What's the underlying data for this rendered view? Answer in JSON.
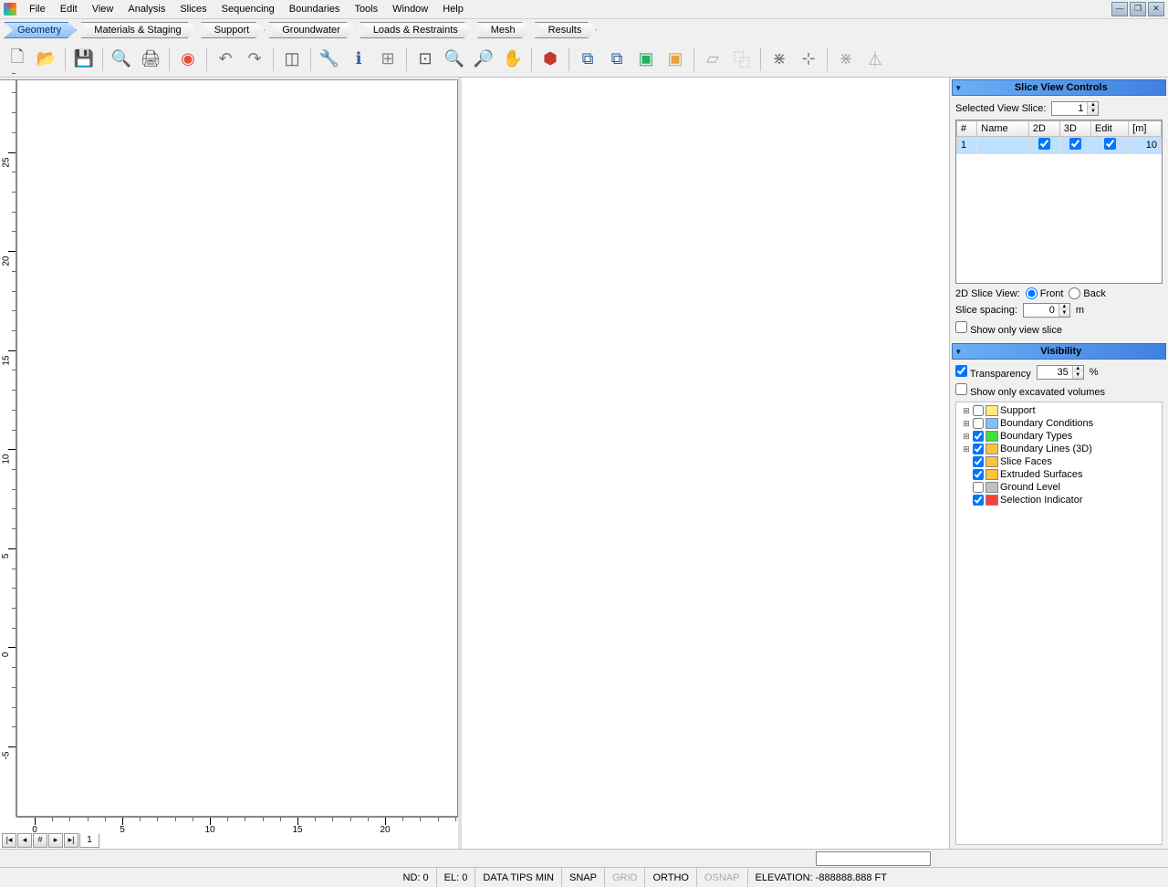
{
  "menu": [
    "File",
    "Edit",
    "View",
    "Analysis",
    "Slices",
    "Sequencing",
    "Boundaries",
    "Tools",
    "Window",
    "Help"
  ],
  "steps": [
    "Geometry",
    "Materials & Staging",
    "Support",
    "Groundwater",
    "Loads & Restraints",
    "Mesh",
    "Results"
  ],
  "activeStep": 0,
  "ruler": {
    "v_labels": [
      "-5",
      "0",
      "5",
      "10",
      "15",
      "20",
      "25"
    ],
    "h_labels": [
      "0",
      "5",
      "10",
      "15",
      "20"
    ]
  },
  "nav": {
    "tab": "1"
  },
  "sliceControls": {
    "title": "Slice View Controls",
    "label_selected": "Selected View Slice:",
    "selected": "1",
    "headers": [
      "#",
      "Name",
      "2D",
      "3D",
      "Edit",
      "[m]"
    ],
    "row": {
      "num": "1",
      "name": "",
      "d2": true,
      "d3": true,
      "edit": true,
      "m": "10"
    },
    "label_2d": "2D Slice View:",
    "opt_front": "Front",
    "opt_back": "Back",
    "label_spacing": "Slice spacing:",
    "spacing": "0",
    "spacing_unit": "m",
    "label_only": "Show only view slice",
    "only": false
  },
  "visibility": {
    "title": "Visibility",
    "transp_label": "Transparency",
    "transp_value": "35",
    "transp_unit": "%",
    "excavated_label": "Show only excavated volumes",
    "excavated": false,
    "tree": [
      {
        "exp": "+",
        "checked": false,
        "label": "Support",
        "color": "#ffeb7f"
      },
      {
        "exp": "+",
        "checked": false,
        "label": "Boundary Conditions",
        "color": "#7fbfff"
      },
      {
        "exp": "+",
        "checked": true,
        "label": "Boundary Types",
        "color": "#40e040"
      },
      {
        "exp": "+",
        "checked": true,
        "label": "Boundary Lines (3D)",
        "color": "#ffc040"
      },
      {
        "exp": "",
        "checked": true,
        "label": "Slice Faces",
        "color": "#ffc040"
      },
      {
        "exp": "",
        "checked": true,
        "label": "Extruded Surfaces",
        "color": "#ffc040"
      },
      {
        "exp": "",
        "checked": false,
        "label": "Ground Level",
        "color": "#c0c0c0"
      },
      {
        "exp": "",
        "checked": true,
        "label": "Selection Indicator",
        "color": "#ff4040"
      }
    ]
  },
  "status": {
    "nd": "ND: 0",
    "el": "EL: 0",
    "dtips": "DATA TIPS MIN",
    "snap": "SNAP",
    "grid": "GRID",
    "ortho": "ORTHO",
    "osnap": "OSNAP",
    "elev": "ELEVATION: -888888.888 FT"
  },
  "toolbar_icons": [
    {
      "n": "new-file-icon",
      "g": "🗋",
      "c": "#666"
    },
    {
      "n": "open-folder-icon",
      "g": "📂",
      "c": "#e6a23c"
    },
    {
      "sep": true
    },
    {
      "n": "save-icon",
      "g": "💾",
      "c": "#2c5aa0"
    },
    {
      "sep": true
    },
    {
      "n": "print-preview-icon",
      "g": "🔍",
      "c": "#555"
    },
    {
      "n": "print-icon",
      "g": "🖨",
      "c": "#555"
    },
    {
      "sep": true
    },
    {
      "n": "color-wheel-icon",
      "g": "◉",
      "c": "#e74c3c"
    },
    {
      "sep": true
    },
    {
      "n": "undo-icon",
      "g": "↶",
      "c": "#777"
    },
    {
      "n": "redo-icon",
      "g": "↷",
      "c": "#777"
    },
    {
      "sep": true
    },
    {
      "n": "split-view-icon",
      "g": "◫",
      "c": "#555"
    },
    {
      "sep": true
    },
    {
      "n": "settings-wrench-icon",
      "g": "🔧",
      "c": "#c0392b"
    },
    {
      "n": "info-panel-icon",
      "g": "ℹ",
      "c": "#2c5aa0"
    },
    {
      "n": "calculator-icon",
      "g": "⊞",
      "c": "#888"
    },
    {
      "sep": true
    },
    {
      "n": "zoom-extents-icon",
      "g": "⊡",
      "c": "#555"
    },
    {
      "n": "zoom-in-icon",
      "g": "🔍",
      "c": "#555"
    },
    {
      "n": "zoom-out-icon",
      "g": "🔎",
      "c": "#555"
    },
    {
      "n": "pan-icon",
      "g": "✋",
      "c": "#e6a23c"
    },
    {
      "sep": true
    },
    {
      "n": "box-view-icon",
      "g": "⬢",
      "c": "#c0392b"
    },
    {
      "sep": true
    },
    {
      "n": "window1-icon",
      "g": "⧉",
      "c": "#2c5aa0"
    },
    {
      "n": "window2-icon",
      "g": "⧉",
      "c": "#2c5aa0"
    },
    {
      "n": "screen-green-icon",
      "g": "▣",
      "c": "#27ae60"
    },
    {
      "n": "screen-yellow-icon",
      "g": "▣",
      "c": "#e6a23c"
    },
    {
      "sep": true
    },
    {
      "n": "select-poly-icon",
      "g": "▱",
      "c": "#aaa"
    },
    {
      "n": "copy-shape-icon",
      "g": "⿻",
      "c": "#aaa"
    },
    {
      "sep": true
    },
    {
      "n": "snap-endpoint-icon",
      "g": "⋇",
      "c": "#777"
    },
    {
      "n": "snap-node-icon",
      "g": "⊹",
      "c": "#777"
    },
    {
      "sep": true
    },
    {
      "n": "snap-tool-icon",
      "g": "⋇",
      "c": "#aaa"
    },
    {
      "n": "filter-icon",
      "g": "⏃",
      "c": "#aaa"
    }
  ]
}
